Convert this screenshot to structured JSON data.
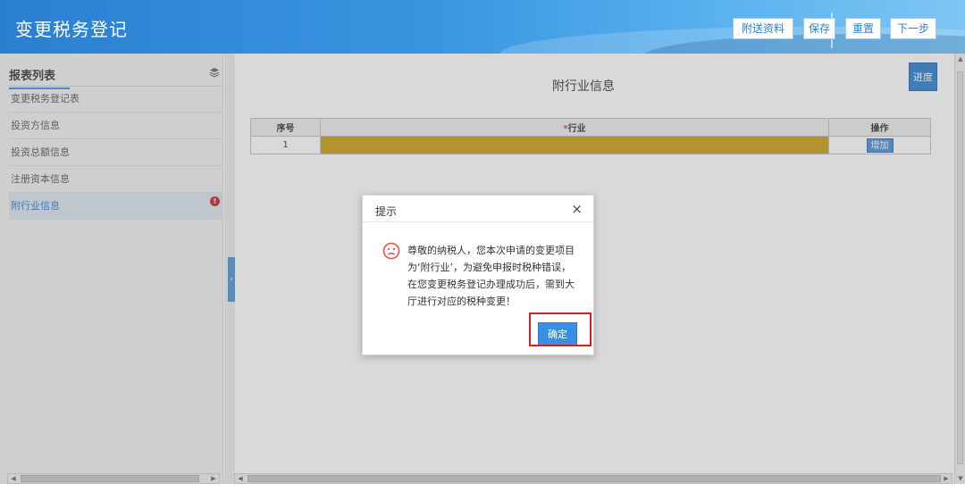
{
  "header": {
    "title": "变更税务登记",
    "buttons": {
      "attach": "附送资料",
      "save": "保存",
      "reset": "重置",
      "next": "下一步"
    }
  },
  "sidebar": {
    "title": "报表列表",
    "items": [
      {
        "label": "变更税务登记表"
      },
      {
        "label": "投资方信息"
      },
      {
        "label": "投资总额信息"
      },
      {
        "label": "注册资本信息"
      },
      {
        "label": "附行业信息",
        "active": true,
        "badge": "!"
      }
    ]
  },
  "main": {
    "title": "附行业信息",
    "progress_label": "进度",
    "table": {
      "headers": {
        "index": "序号",
        "required_mark": "*",
        "industry": "行业",
        "action": "操作"
      },
      "rows": [
        {
          "index": "1",
          "industry": "",
          "action": "增加"
        }
      ]
    }
  },
  "dialog": {
    "title": "提示",
    "close_symbol": "×",
    "message": "尊敬的纳税人，您本次申请的变更项目为‘附行业’，为避免申报时税种错误，在您变更税务登记办理成功后，需到大厅进行对应的税种变更！",
    "confirm_label": "确定"
  },
  "colors": {
    "header_blue": "#2b7fd1",
    "industry_cell": "#c8a014",
    "highlight_red": "#d81e1e"
  },
  "icons": {
    "layers": "layers-icon",
    "sad_face": "sad-face-icon",
    "close": "close-icon"
  }
}
